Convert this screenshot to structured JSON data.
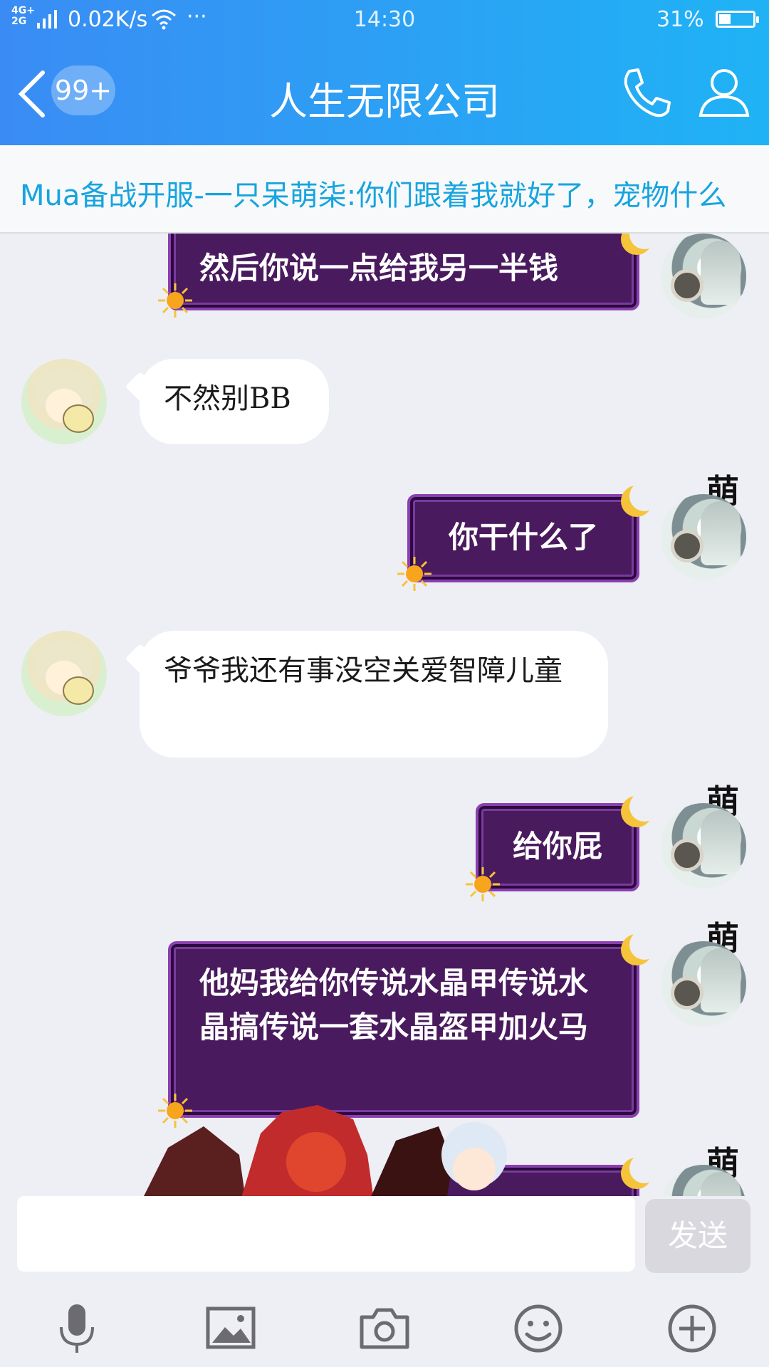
{
  "status_bar": {
    "network": "4G+\n2G",
    "speed": "0.02K/s",
    "more": "···",
    "time": "14:30",
    "battery": "31%",
    "battery_level": 0.31
  },
  "header": {
    "badge": "99+",
    "title": "人生无限公司"
  },
  "notice": {
    "text": "Mua备战开服-一只呆萌柒:你们跟着我就好了，宠物什么"
  },
  "messages": [
    {
      "side": "right",
      "text": "然后你说一点给我另一半钱"
    },
    {
      "side": "left",
      "text": "不然别BB"
    },
    {
      "side": "right",
      "tag": "萌",
      "text": "你干什么了"
    },
    {
      "side": "left",
      "text": "爷爷我还有事没空关爱智障儿童"
    },
    {
      "side": "right",
      "tag": "萌",
      "text": "给你屁"
    },
    {
      "side": "right",
      "tag": "萌",
      "text": "他妈我给你传说水晶甲传说水晶搞传说一套水晶盔甲加火马"
    },
    {
      "side": "right",
      "tag": "萌",
      "text": ""
    }
  ],
  "input": {
    "value": "",
    "send_label": "发送"
  },
  "toolbar": [
    "microphone-icon",
    "image-icon",
    "camera-icon",
    "emoji-icon",
    "plus-icon"
  ]
}
